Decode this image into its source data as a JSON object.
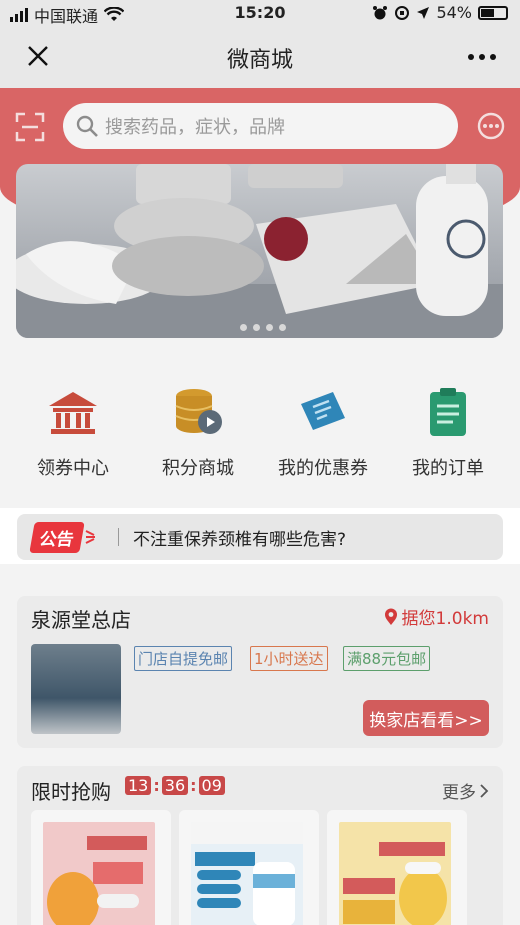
{
  "status": {
    "carrier": "中国联通",
    "time": "15:20",
    "battery": "54%"
  },
  "nav": {
    "title": "微商城"
  },
  "search": {
    "placeholder": "搜索药品，症状，品牌"
  },
  "menu": [
    {
      "label": "领券中心",
      "icon": "bank-icon",
      "color": "#c74b3b"
    },
    {
      "label": "积分商城",
      "icon": "coins-icon",
      "color": "#d39a2e"
    },
    {
      "label": "我的优惠券",
      "icon": "ticket-icon",
      "color": "#2f86b8"
    },
    {
      "label": "我的订单",
      "icon": "clipboard-icon",
      "color": "#2a9a70"
    }
  ],
  "notice": {
    "badge": "公告",
    "text": "不注重保养颈椎有哪些危害?"
  },
  "store": {
    "name": "泉源堂总店",
    "distance": "据您1.0km",
    "tags": [
      {
        "text": "门店自提免邮",
        "color": "#5b84b0"
      },
      {
        "text": "1小时送达",
        "color": "#d8774d"
      },
      {
        "text": "满88元包邮",
        "color": "#5c9f6c"
      }
    ],
    "switch_button": "换家店看看>>"
  },
  "flash": {
    "title": "限时抢购",
    "countdown": [
      "13",
      "36",
      "09"
    ],
    "more": "更多"
  },
  "colors": {
    "accent": "#d96565",
    "notice_badge": "#e8363d"
  }
}
